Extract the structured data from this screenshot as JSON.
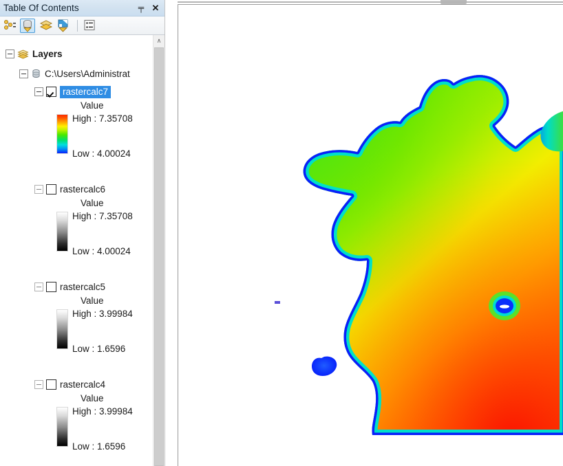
{
  "panel": {
    "title": "Table Of Contents",
    "pin_label": "╤",
    "close_label": "✕",
    "pin_name": "auto-hide-pin",
    "close_name": "close-panel"
  },
  "toolbar": {
    "buttons": [
      {
        "name": "list-by-drawing-order-icon",
        "tooltip": "List By Drawing Order",
        "selected": false
      },
      {
        "name": "list-by-source-icon",
        "tooltip": "List By Source",
        "selected": true
      },
      {
        "name": "list-by-visibility-icon",
        "tooltip": "List By Visibility",
        "selected": false
      },
      {
        "name": "list-by-selection-icon",
        "tooltip": "List By Selection",
        "selected": false
      },
      {
        "name": "options-list-icon",
        "tooltip": "Options",
        "selected": false
      }
    ]
  },
  "tree": {
    "root": {
      "label": "Layers",
      "expanded": true
    },
    "workspace": {
      "label": "C:\\Users\\Administrat",
      "expanded": true
    },
    "layers": [
      {
        "name": "rastercalc7",
        "checked": true,
        "selected": true,
        "expanded": true,
        "value_label": "Value",
        "high": "High : 7.35708",
        "low": "Low : 4.00024",
        "ramp": "rainbow"
      },
      {
        "name": "rastercalc6",
        "checked": false,
        "selected": false,
        "expanded": true,
        "value_label": "Value",
        "high": "High : 7.35708",
        "low": "Low : 4.00024",
        "ramp": "grayscale"
      },
      {
        "name": "rastercalc5",
        "checked": false,
        "selected": false,
        "expanded": true,
        "value_label": "Value",
        "high": "High : 3.99984",
        "low": "Low : 1.6596",
        "ramp": "grayscale"
      },
      {
        "name": "rastercalc4",
        "checked": false,
        "selected": false,
        "expanded": true,
        "value_label": "Value",
        "high": "High : 3.99984",
        "low": "Low : 1.6596",
        "ramp": "grayscale"
      }
    ]
  },
  "scrollbar": {
    "up_arrow": "∧",
    "orientation": "vertical"
  },
  "map": {
    "layer_drawn": "rastercalc7",
    "colors": {
      "low": "#0a1ffb",
      "mid_low": "#00dede",
      "mid": "#49e800",
      "mid_high": "#fff000",
      "high": "#fb2b00",
      "nodata": "#ffffff"
    },
    "value_range": {
      "low": 4.00024,
      "high": 7.35708
    }
  }
}
